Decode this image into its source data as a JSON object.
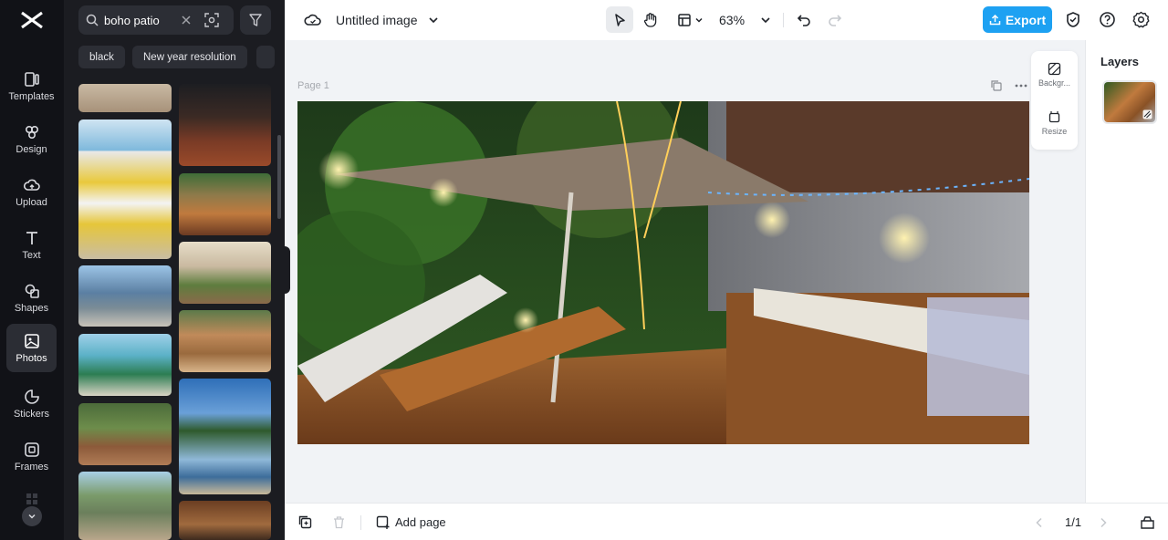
{
  "rail": {
    "items": [
      {
        "label": "Templates"
      },
      {
        "label": "Design"
      },
      {
        "label": "Upload"
      },
      {
        "label": "Text"
      },
      {
        "label": "Shapes"
      },
      {
        "label": "Photos"
      },
      {
        "label": "Stickers"
      },
      {
        "label": "Frames"
      }
    ],
    "active": "Photos"
  },
  "search": {
    "value": "boho patio"
  },
  "chips": [
    "black",
    "New year resolution"
  ],
  "topbar": {
    "title": "Untitled image",
    "zoom": "63%",
    "export_label": "Export"
  },
  "canvas": {
    "page_label": "Page 1"
  },
  "floating_tools": {
    "background_label": "Backgr...",
    "resize_label": "Resize"
  },
  "layers": {
    "title": "Layers"
  },
  "bottombar": {
    "add_page_label": "Add page",
    "page_indicator": "1/1"
  },
  "colors": {
    "accent": "#1da1f2",
    "rail_bg": "#111217",
    "panel_bg": "#1b1c21"
  }
}
